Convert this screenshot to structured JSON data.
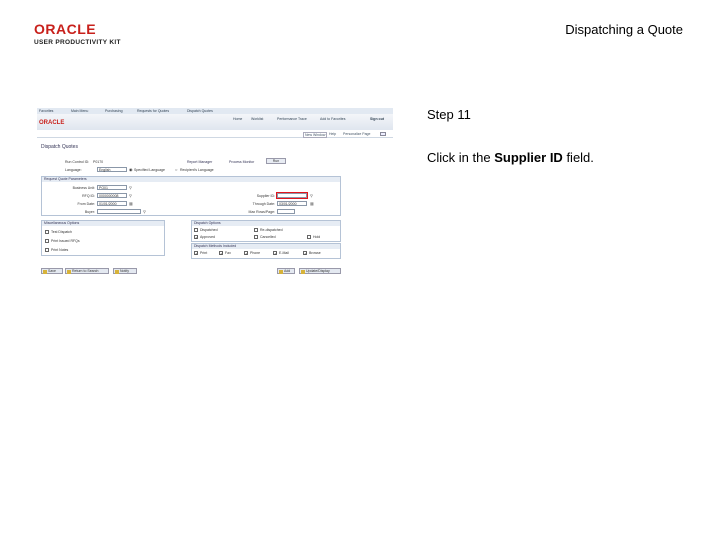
{
  "slide": {
    "logo_brand": "ORACLE",
    "logo_sub": "USER PRODUCTIVITY KIT",
    "title": "Dispatching a Quote",
    "step": "Step 11",
    "instruction_pre": "Click in the ",
    "instruction_bold": "Supplier ID",
    "instruction_post": " field."
  },
  "screenshot": {
    "menubar": [
      "Favorites",
      "Main Menu",
      "Purchasing",
      "Requests for Quotes",
      "Dispatch Quotes"
    ],
    "brand": "ORACLE",
    "nav": [
      "Home",
      "Worklist",
      "Performance Trace",
      "Add to Favorites",
      "Sign out"
    ],
    "util": [
      "New Window",
      "Help",
      "Personalize Page"
    ],
    "page_title": "Dispatch Quotes",
    "run_control_label": "Run Control ID:",
    "run_control_value": "P0170",
    "report_manager": "Report Manager",
    "process_monitor": "Process Monitor",
    "run_button": "Run",
    "language_label": "Language:",
    "language_value": "English",
    "specified_language": "Specified Language",
    "recipient_language": "Recipient's Language",
    "request_params": {
      "header": "Request Quote Parameters",
      "business_unit_label": "Business Unit:",
      "business_unit_value": "PO01",
      "rfq_id_label": "RFQ ID:",
      "rfq_id_value": "0000000008",
      "from_date_label": "From Date:",
      "from_date_value": "01/01/2000",
      "supplier_id_label": "Supplier ID:",
      "through_date_label": "Through Date:",
      "through_date_value": "03/01/2000",
      "buyer_label": "Buyer:",
      "max_rows_label": "Max Rows/Page:"
    },
    "misc_options": {
      "header": "Miscellaneous Options",
      "items": [
        "Test Dispatch",
        "Print Issued RFQs",
        "Print Notes"
      ]
    },
    "dispatch_options": {
      "header": "Dispatch Options",
      "items": [
        "Dispatched",
        "Re-dispatched",
        "Approved",
        "Cancelled",
        "Hold"
      ]
    },
    "dispatch_methods": {
      "header": "Dispatch Methods Included",
      "items": [
        "Print",
        "Fax",
        "Phone",
        "E-Mail",
        "Browse"
      ]
    },
    "buttons": {
      "save": "Save",
      "return": "Return to Search",
      "notify": "Notify",
      "add": "Add",
      "update": "Update/Display"
    }
  }
}
